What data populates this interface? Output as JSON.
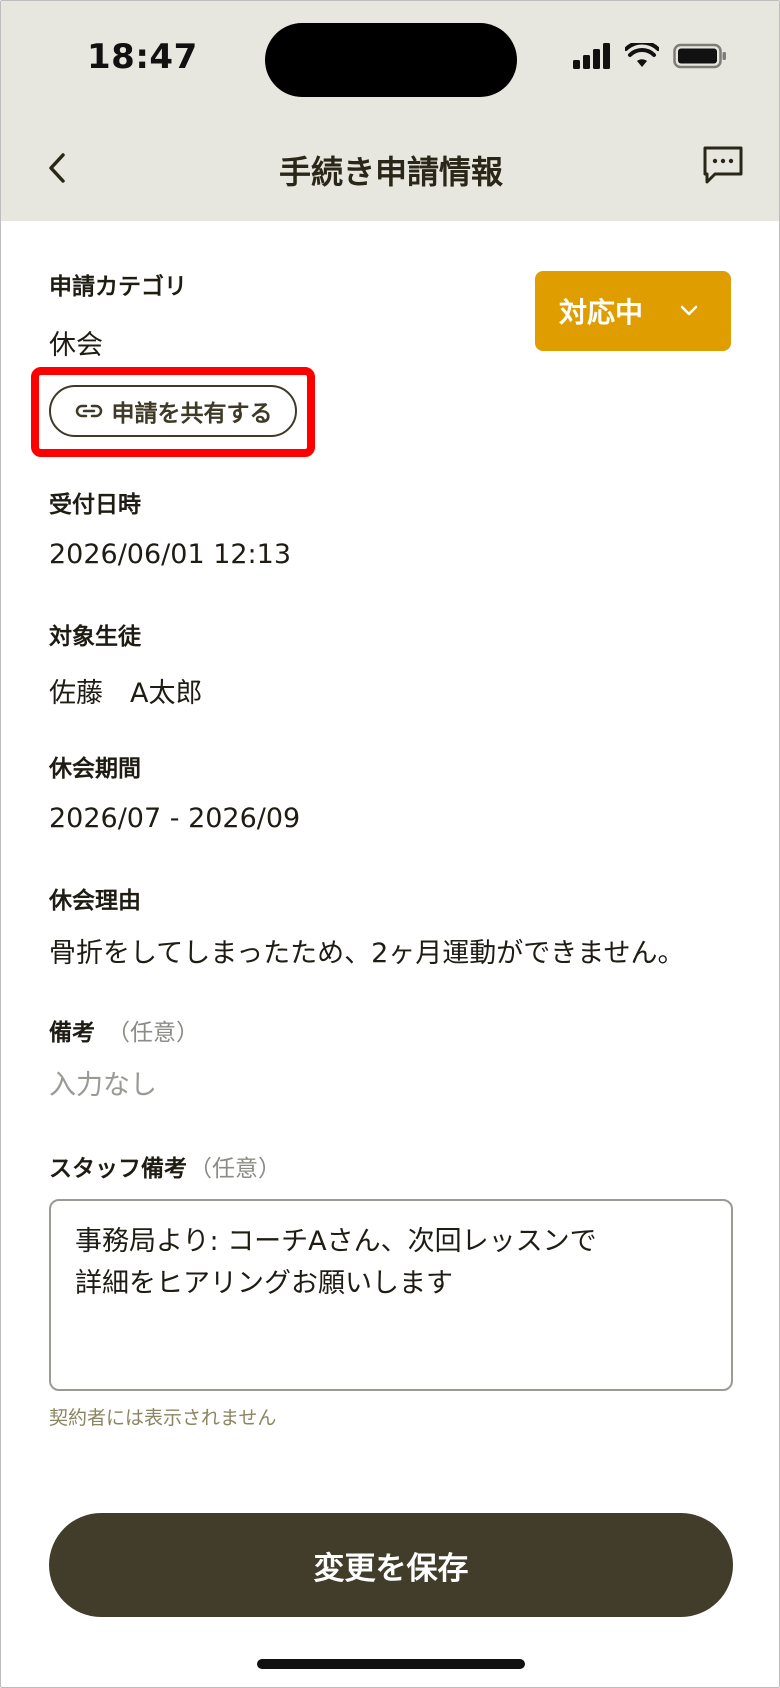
{
  "status_bar": {
    "time": "18:47"
  },
  "nav": {
    "title": "手続き申請情報"
  },
  "request": {
    "category_label": "申請カテゴリ",
    "category_value": "休会",
    "status_label": "対応中",
    "share_label": "申請を共有する"
  },
  "fields": {
    "received_label": "受付日時",
    "received_value": "2026/06/01 12:13",
    "student_label": "対象生徒",
    "student_value": "佐藤　A太郎",
    "period_label": "休会期間",
    "period_value": "2026/07 - 2026/09",
    "reason_label": "休会理由",
    "reason_value": "骨折をしてしまったため、2ヶ月運動ができません。",
    "remarks_label": "備考",
    "remarks_optional": "（任意）",
    "remarks_value": "入力なし",
    "staff_remarks_label": "スタッフ備考",
    "staff_remarks_optional": "（任意）",
    "staff_remarks_line1": "事務局より: コーチAさん、次回レッスンで",
    "staff_remarks_line2": "詳細をヒアリングお願いします",
    "staff_remarks_note": "契約者には表示されません"
  },
  "actions": {
    "save_label": "変更を保存"
  },
  "colors": {
    "accent": "#e09d00",
    "primary": "#413d2a",
    "header_bg": "#e8e7df",
    "highlight": "#ff0000"
  }
}
